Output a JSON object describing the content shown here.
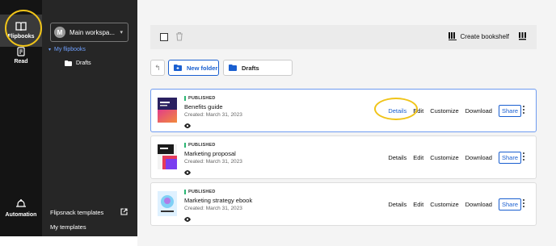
{
  "rail": {
    "flipbooks_label": "Flipbooks",
    "read_label": "Read",
    "automation_label": "Automation"
  },
  "sidebar": {
    "workspace_initial": "M",
    "workspace_label": "Main workspa...",
    "my_flipbooks_label": "My flipbooks",
    "drafts_label": "Drafts",
    "templates_label": "Flipsnack templates",
    "my_templates_label": "My templates"
  },
  "toolbar": {
    "create_bookshelf_label": "Create bookshelf"
  },
  "folders": {
    "new_folder_label": "New folder",
    "current_folder_label": "Drafts"
  },
  "flipbooks": [
    {
      "status": "PUBLISHED",
      "title": "Benefits guide",
      "created": "Created: March 31, 2023"
    },
    {
      "status": "PUBLISHED",
      "title": "Marketing proposal",
      "created": "Created: March 31, 2023"
    },
    {
      "status": "PUBLISHED",
      "title": "Marketing strategy ebook",
      "created": "Created: March 31, 2023"
    }
  ],
  "actions": {
    "details": "Details",
    "edit": "Edit",
    "customize": "Customize",
    "download": "Download",
    "share": "Share"
  },
  "colors": {
    "accent": "#1a5fd0",
    "highlight": "#f0c419",
    "published": "#2bb673",
    "rail_bg": "#141414",
    "sidebar_bg": "#262626"
  }
}
